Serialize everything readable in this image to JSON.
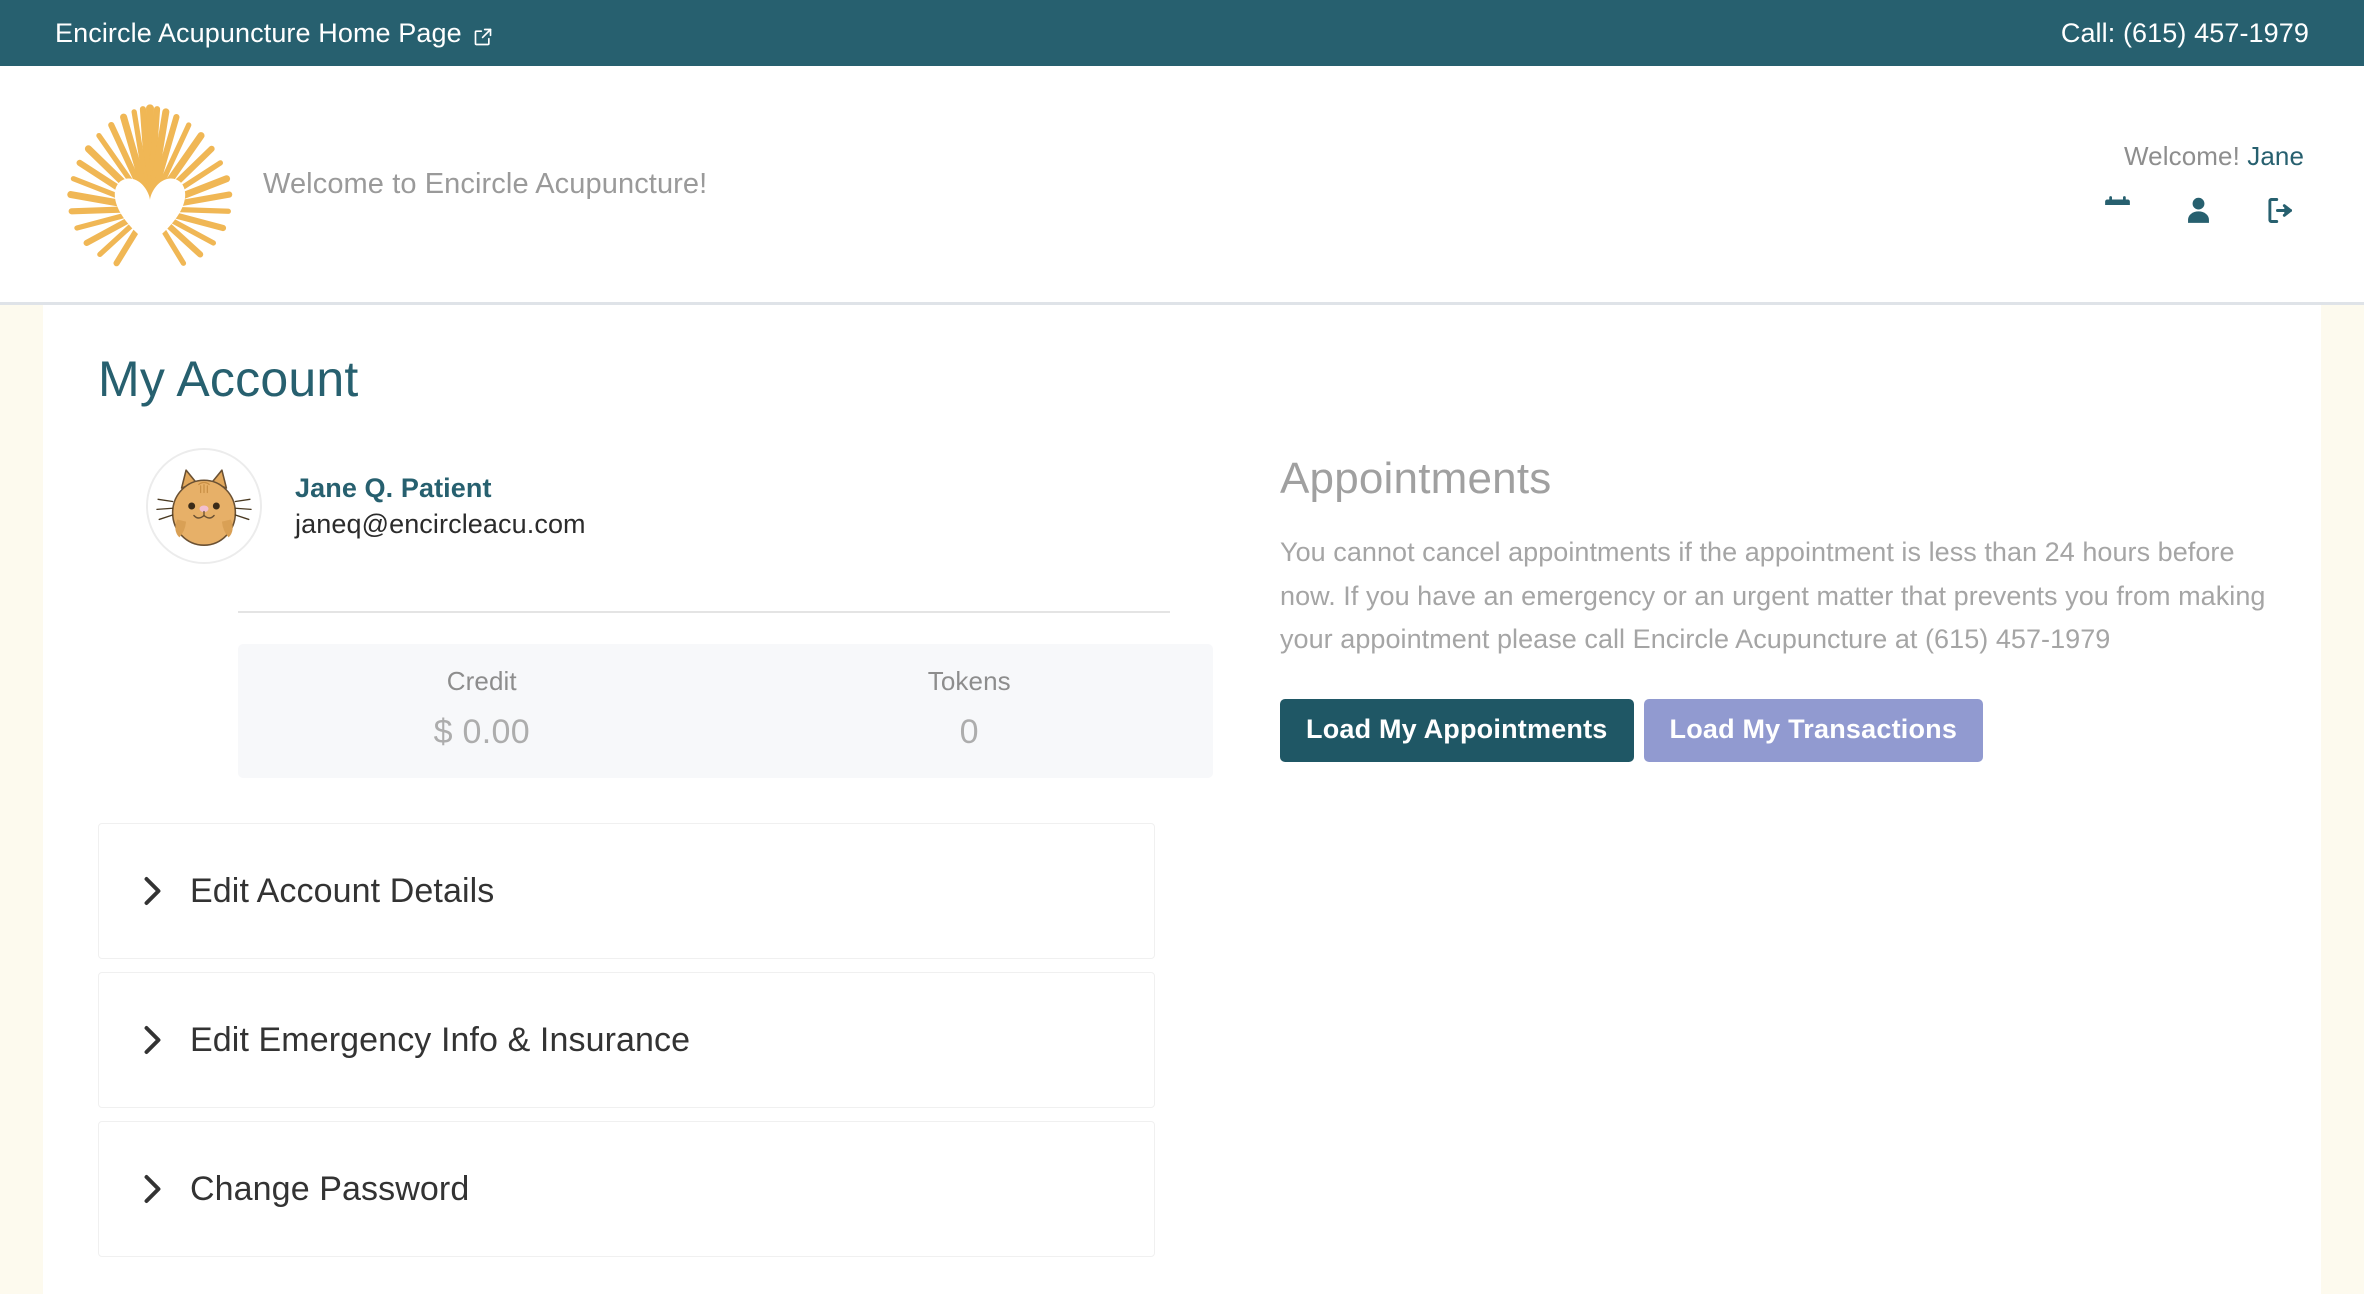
{
  "topbar": {
    "home_link_label": "Encircle Acupuncture Home Page",
    "home_link_icon": "external-link-icon",
    "phone_label": "Call: (615) 457-1979"
  },
  "header": {
    "logo_icon": "sunburst-heart-logo",
    "tagline": "Welcome to Encircle Acupuncture!",
    "welcome_prefix": "Welcome! ",
    "welcome_user": "Jane",
    "icons": [
      {
        "name": "calendar-icon",
        "label": "Calendar"
      },
      {
        "name": "user-icon",
        "label": "My Account"
      },
      {
        "name": "logout-icon",
        "label": "Log Out"
      }
    ]
  },
  "main": {
    "title": "My Account",
    "profile": {
      "avatar_icon": "cat-avatar",
      "name": "Jane Q. Patient",
      "email": "janeq@encircleacu.com"
    },
    "stats": [
      {
        "label": "Credit",
        "value": "$ 0.00"
      },
      {
        "label": "Tokens",
        "value": "0"
      }
    ],
    "accordion": [
      {
        "icon": "chevron-right-icon",
        "label": "Edit Account Details"
      },
      {
        "icon": "chevron-right-icon",
        "label": "Edit Emergency Info & Insurance"
      },
      {
        "icon": "chevron-right-icon",
        "label": "Change Password"
      }
    ],
    "appointments": {
      "title": "Appointments",
      "note": "You cannot cancel appointments if the appointment is less than 24 hours before now. If you have an emergency or an urgent matter that prevents you from making your appointment please call Encircle Acupuncture at (615) 457-1979",
      "load_appointments_label": "Load My Appointments",
      "load_transactions_label": "Load My Transactions"
    }
  },
  "colors": {
    "brand_teal": "#27606F",
    "button_primary": "#1F5765",
    "button_secondary": "#919AD0",
    "logo_gold": "#F0B755",
    "page_background": "#FDFAEE",
    "content_background": "#FFFFFF"
  }
}
